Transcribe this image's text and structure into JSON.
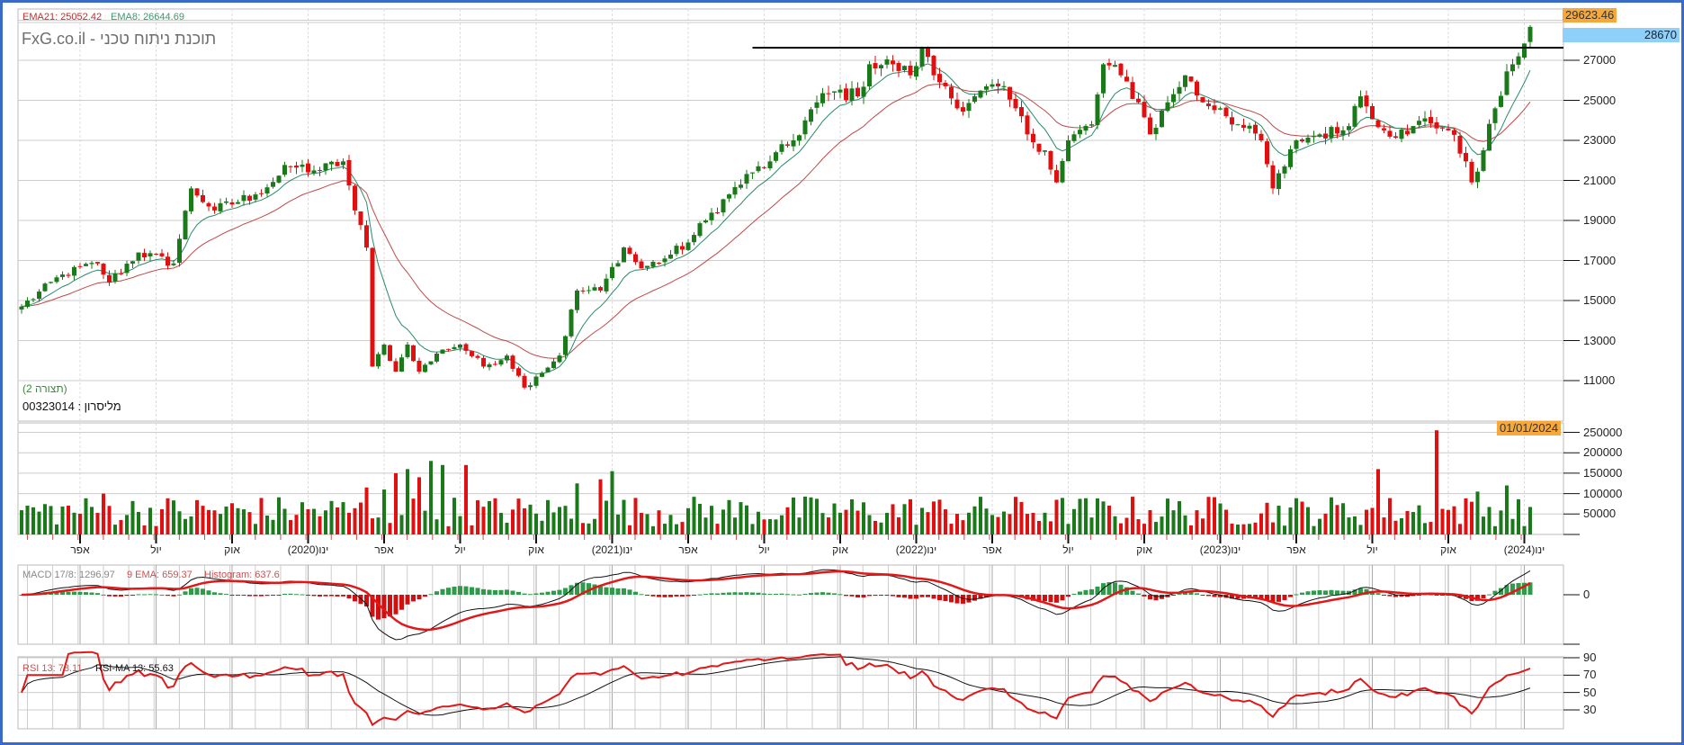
{
  "header": {
    "ema21_label": "EMA21: 25052.42",
    "ema8_label": "EMA8: 26644.69",
    "title": "FxG.co.il - תוכנת ניתוח טכני",
    "config_label": "(תצורה 2)",
    "security_label": "מליסרון : 00323014"
  },
  "tags": {
    "high_price": "29623.46",
    "current_price": "28670",
    "current_date": "01/01/2024"
  },
  "macd_legend": {
    "macd": "MACD 17/8: 1296.97",
    "signal": "9 EMA: 659.37",
    "histogram": "Histogram: 637.6"
  },
  "rsi_legend": {
    "rsi": "RSI 13: 73.11",
    "rsi_ma": "RSI-MA 13: 55.63"
  },
  "colors": {
    "up": "#1a7a1a",
    "down": "#e01010",
    "ema21": "#c04848",
    "ema8": "#2a8a6a",
    "frame": "#3a6bc8",
    "tag_orange": "#f7a83c",
    "tag_blue": "#8fd0fb"
  },
  "chart_data": {
    "type": "candlestick",
    "interval": "weekly",
    "price_axis": {
      "ticks": [
        "27000",
        "25000",
        "23000",
        "21000",
        "19000",
        "17000",
        "15000",
        "13000",
        "11000"
      ],
      "values": [
        27000,
        25000,
        23000,
        21000,
        19000,
        17000,
        15000,
        13000,
        11000
      ]
    },
    "volume_axis": {
      "ticks": [
        "250000",
        "200000",
        "150000",
        "100000",
        "50000"
      ],
      "values": [
        250000,
        200000,
        150000,
        100000,
        50000
      ]
    },
    "macd_axis": {
      "ticks": [
        "0"
      ]
    },
    "rsi_axis": {
      "ticks": [
        "90",
        "70",
        "50",
        "30"
      ],
      "values": [
        90,
        70,
        50,
        30
      ]
    },
    "x_labels": [
      {
        "label": "אפר",
        "week": 10
      },
      {
        "label": "יול",
        "week": 23
      },
      {
        "label": "אוק",
        "week": 36
      },
      {
        "label": "ינו(2020)",
        "week": 49
      },
      {
        "label": "אפר",
        "week": 62
      },
      {
        "label": "יול",
        "week": 75
      },
      {
        "label": "אוק",
        "week": 88
      },
      {
        "label": "ינו(2021)",
        "week": 101
      },
      {
        "label": "אפר",
        "week": 114
      },
      {
        "label": "יול",
        "week": 127
      },
      {
        "label": "אוק",
        "week": 140
      },
      {
        "label": "ינו(2022)",
        "week": 153
      },
      {
        "label": "אפר",
        "week": 166
      },
      {
        "label": "יול",
        "week": 179
      },
      {
        "label": "אוק",
        "week": 192
      },
      {
        "label": "ינו(2023)",
        "week": 205
      },
      {
        "label": "אפר",
        "week": 218
      },
      {
        "label": "יול",
        "week": 231
      },
      {
        "label": "אוק",
        "week": 244
      },
      {
        "label": "ינו(2024)",
        "week": 257
      }
    ],
    "close_keypoints": [
      [
        0,
        14700
      ],
      [
        7,
        16300
      ],
      [
        13,
        16850
      ],
      [
        15,
        15900
      ],
      [
        20,
        17400
      ],
      [
        26,
        16850
      ],
      [
        29,
        20600
      ],
      [
        33,
        19500
      ],
      [
        40,
        20300
      ],
      [
        46,
        21700
      ],
      [
        51,
        21500
      ],
      [
        55,
        21950
      ],
      [
        57,
        19500
      ],
      [
        59,
        17650
      ],
      [
        60,
        11700
      ],
      [
        62,
        12800
      ],
      [
        64,
        11450
      ],
      [
        66,
        12800
      ],
      [
        68,
        11450
      ],
      [
        72,
        12550
      ],
      [
        75,
        12800
      ],
      [
        79,
        11700
      ],
      [
        83,
        12250
      ],
      [
        86,
        10650
      ],
      [
        88,
        11200
      ],
      [
        92,
        12250
      ],
      [
        95,
        15500
      ],
      [
        99,
        15500
      ],
      [
        103,
        17650
      ],
      [
        106,
        16600
      ],
      [
        110,
        17100
      ],
      [
        114,
        17900
      ],
      [
        117,
        19000
      ],
      [
        121,
        20300
      ],
      [
        125,
        21400
      ],
      [
        128,
        21950
      ],
      [
        132,
        23000
      ],
      [
        136,
        24900
      ],
      [
        139,
        25450
      ],
      [
        143,
        25200
      ],
      [
        145,
        26800
      ],
      [
        149,
        26800
      ],
      [
        152,
        26250
      ],
      [
        154,
        27600
      ],
      [
        156,
        26250
      ],
      [
        158,
        25700
      ],
      [
        160,
        24600
      ],
      [
        163,
        25200
      ],
      [
        167,
        25700
      ],
      [
        170,
        24600
      ],
      [
        172,
        23300
      ],
      [
        175,
        22500
      ],
      [
        177,
        20900
      ],
      [
        179,
        23000
      ],
      [
        183,
        23800
      ],
      [
        185,
        26800
      ],
      [
        188,
        26250
      ],
      [
        191,
        24900
      ],
      [
        193,
        23300
      ],
      [
        196,
        24900
      ],
      [
        199,
        26250
      ],
      [
        202,
        24900
      ],
      [
        205,
        24600
      ],
      [
        208,
        23800
      ],
      [
        212,
        23000
      ],
      [
        214,
        20600
      ],
      [
        216,
        21700
      ],
      [
        218,
        23000
      ],
      [
        222,
        23300
      ],
      [
        226,
        23500
      ],
      [
        229,
        25200
      ],
      [
        233,
        23500
      ],
      [
        237,
        23300
      ],
      [
        240,
        24100
      ],
      [
        244,
        23500
      ],
      [
        247,
        21950
      ],
      [
        248,
        20900
      ],
      [
        250,
        22500
      ],
      [
        252,
        24600
      ],
      [
        255,
        26800
      ],
      [
        258,
        28670
      ]
    ],
    "volume_spikes": [
      [
        14,
        100000
      ],
      [
        59,
        115000
      ],
      [
        62,
        110000
      ],
      [
        64,
        150000
      ],
      [
        66,
        160000
      ],
      [
        68,
        140000
      ],
      [
        70,
        180000
      ],
      [
        72,
        170000
      ],
      [
        76,
        170000
      ],
      [
        95,
        125000
      ],
      [
        99,
        135000
      ],
      [
        101,
        155000
      ],
      [
        242,
        255000
      ],
      [
        232,
        160000
      ],
      [
        249,
        105000
      ],
      [
        254,
        120000
      ]
    ],
    "resistance_line": {
      "price": 27630,
      "from_week": 125
    },
    "indicators": {
      "ema": [
        8,
        21
      ],
      "macd": [
        17,
        8,
        9
      ],
      "rsi": 13,
      "rsi_ma": 13
    }
  }
}
